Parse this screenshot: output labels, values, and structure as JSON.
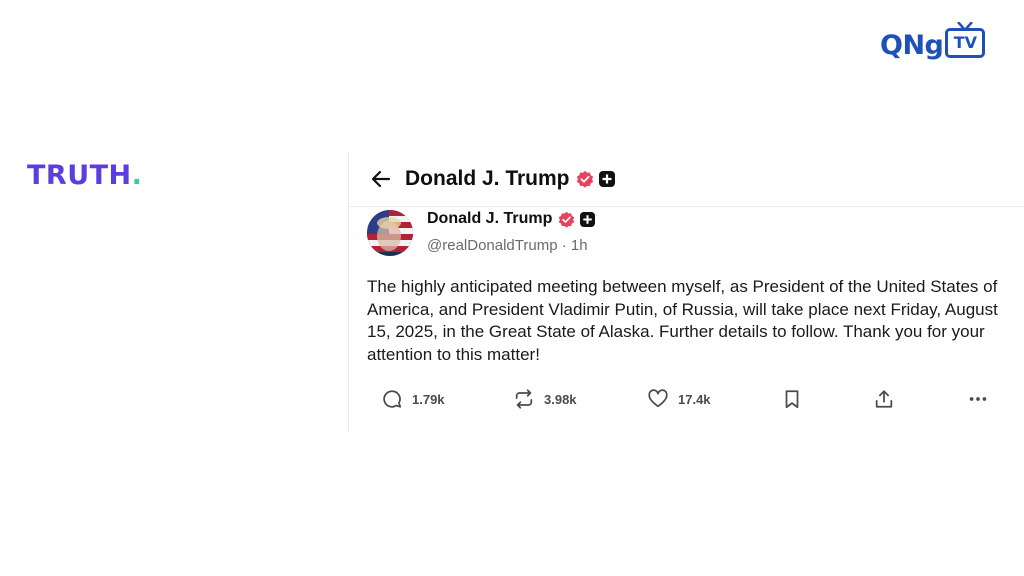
{
  "brand": {
    "truth_logo": "TRUTH",
    "truth_logo_dot": ".",
    "tv_logo_text": "QNg",
    "tv_logo_box": "TV",
    "truth_color": "#5b3ee0",
    "truth_dot_color": "#2ad2a6",
    "tv_color": "#1f4fb8"
  },
  "header": {
    "back_icon": "arrow-left-icon",
    "title": "Donald J. Trump"
  },
  "post": {
    "author_name": "Donald J. Trump",
    "handle": "@realDonaldTrump · 1h",
    "verified_color": "#e9425e",
    "text": "The highly anticipated meeting between myself, as President of the United States of America, and President Vladimir Putin, of Russia, will take place next Friday, August 15, 2025, in the Great State of Alaska. Further details to follow. Thank you for your attention to this matter!"
  },
  "actions": {
    "replies": "1.79k",
    "retruths": "3.98k",
    "likes": "17.4k"
  }
}
